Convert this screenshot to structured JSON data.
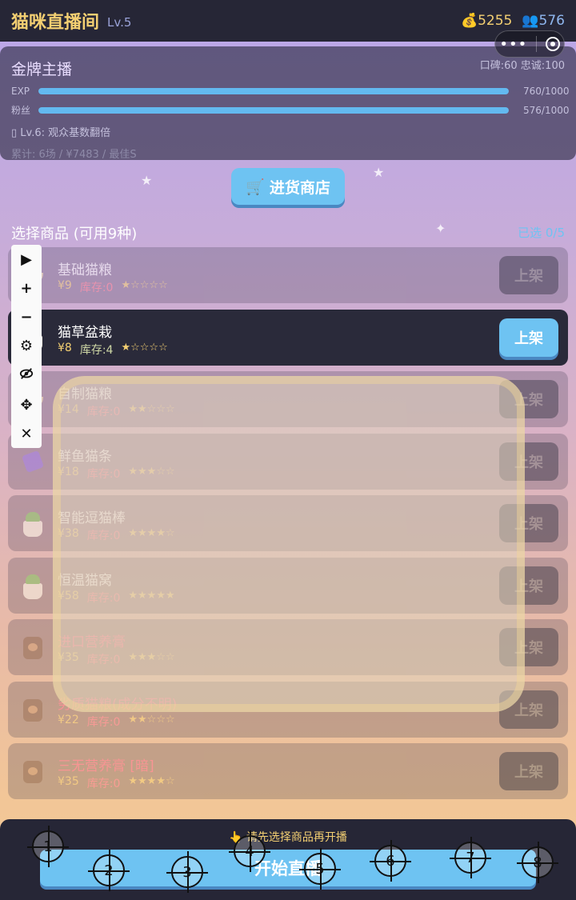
{
  "header": {
    "title": "猫咪直播间",
    "level": "Lv.5",
    "coins_icon": "money-bag-icon",
    "coins": "5255",
    "fans_icon": "people-icon",
    "fans": "576"
  },
  "profile": {
    "rank": "金牌主播",
    "reputation": "口碑:60 忠诚:100",
    "exp_label": "EXP",
    "exp_value": "760/1000",
    "exp_progress": 1.0,
    "fans_label": "粉丝",
    "fans_value": "576/1000",
    "fans_progress": 1.0,
    "perk": "▯ Lv.6: 观众基数翻倍",
    "stats": "累计: 6场 / ¥7483 / 最佳S"
  },
  "shop_button": "进货商店",
  "section": {
    "title": "选择商品 (可用9种)",
    "selected": "已选 0/5"
  },
  "items": [
    {
      "name": "基础猫粮",
      "price": "¥9",
      "stock": "库存:0",
      "stars": "★☆☆☆☆",
      "button": "上架",
      "active": false,
      "thumb": "bowl"
    },
    {
      "name": "猫草盆栽",
      "price": "¥8",
      "stock": "库存:4",
      "stars": "★☆☆☆☆",
      "button": "上架",
      "active": true,
      "thumb": "pot"
    },
    {
      "name": "自制猫粮",
      "price": "¥14",
      "stock": "库存:0",
      "stars": "★★☆☆☆",
      "button": "上架",
      "active": false,
      "thumb": "bowl"
    },
    {
      "name": "鲜鱼猫条",
      "price": "¥18",
      "stock": "库存:0",
      "stars": "★★★☆☆",
      "button": "上架",
      "active": false,
      "thumb": "pack"
    },
    {
      "name": "智能逗猫棒",
      "price": "¥38",
      "stock": "库存:0",
      "stars": "★★★★☆",
      "button": "上架",
      "active": false,
      "thumb": "pot"
    },
    {
      "name": "恒温猫窝",
      "price": "¥58",
      "stock": "库存:0",
      "stars": "★★★★★",
      "button": "上架",
      "active": false,
      "thumb": "pot"
    },
    {
      "name": "进口营养膏",
      "price": "¥35",
      "stock": "库存:0",
      "stars": "★★★☆☆",
      "button": "上架",
      "active": false,
      "thumb": "bag",
      "warn": true
    },
    {
      "name": "劣质猫粮(成分不明)",
      "price": "¥22",
      "stock": "库存:0",
      "stars": "★★☆☆☆",
      "button": "上架",
      "active": false,
      "thumb": "bag",
      "warn": true
    },
    {
      "name": "三无营养膏 [暗]",
      "price": "¥35",
      "stock": "库存:0",
      "stars": "★★★★☆",
      "button": "上架",
      "active": false,
      "thumb": "bag",
      "warn": true
    }
  ],
  "bottom": {
    "hint": "请先选择商品再开播",
    "hint_icon": "pointing-hand-icon",
    "start_button": "开始直播"
  },
  "targets": [
    "1",
    "2",
    "3",
    "4",
    "5",
    "6",
    "7",
    "8"
  ]
}
